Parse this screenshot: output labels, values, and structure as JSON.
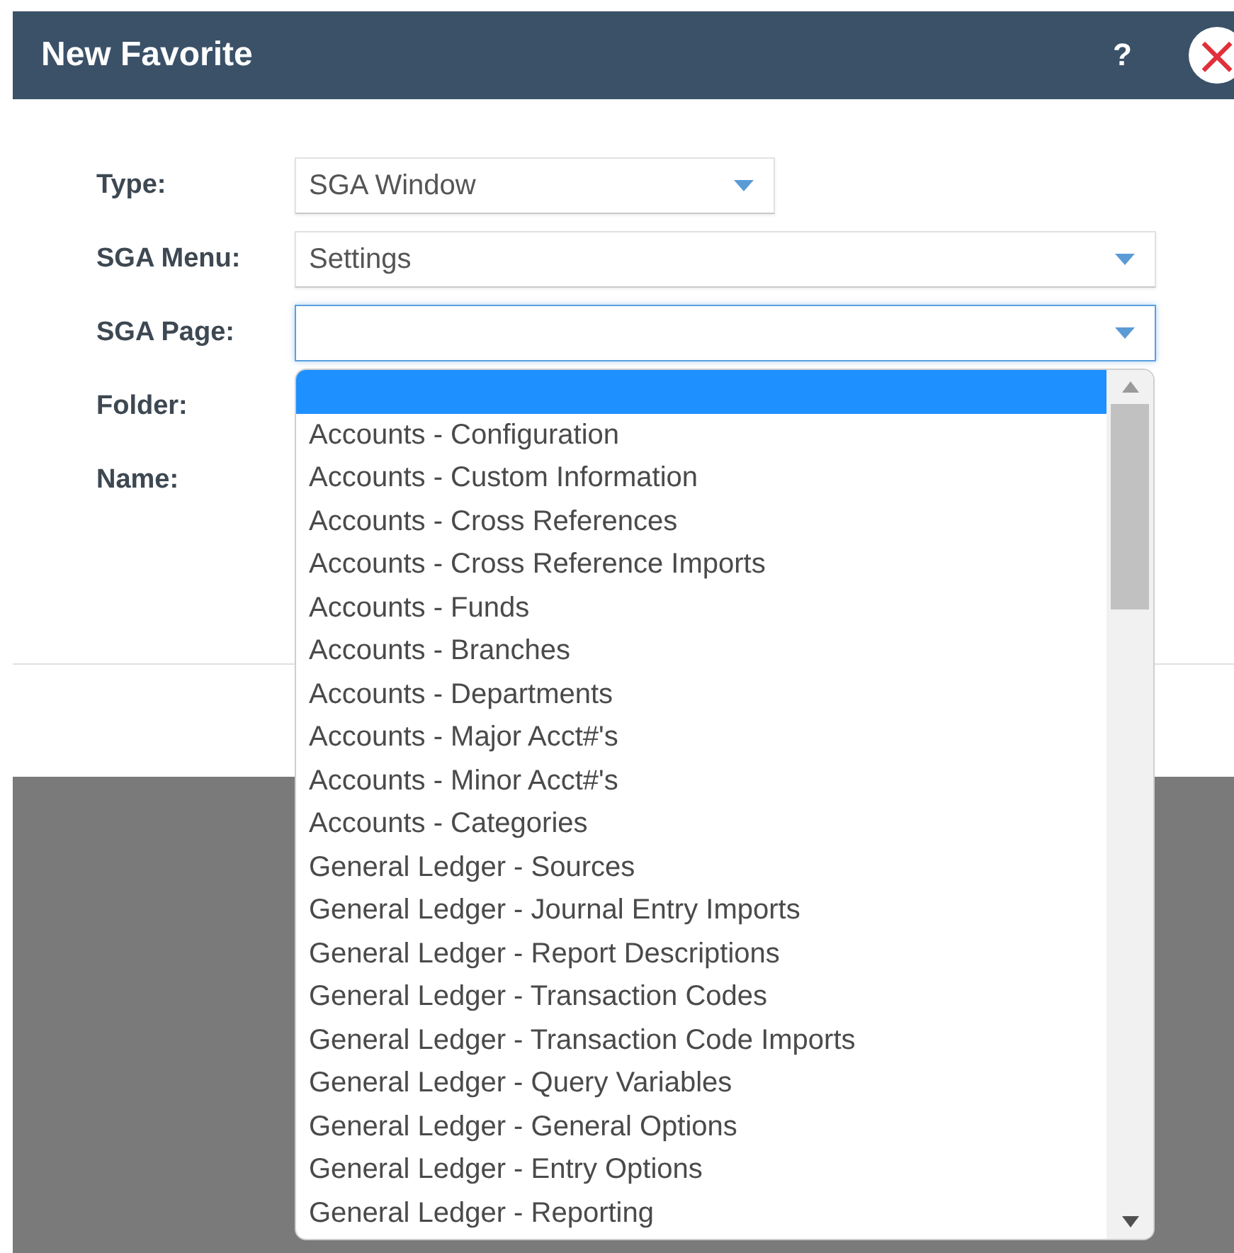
{
  "dialog": {
    "title": "New Favorite",
    "help": "?",
    "close": "×"
  },
  "fields": [
    {
      "label": "Type:",
      "kind": "select",
      "value": "SGA Window",
      "focused": false
    },
    {
      "label": "SGA Menu:",
      "kind": "select",
      "value": "Settings",
      "focused": false
    },
    {
      "label": "SGA Page:",
      "kind": "select",
      "focused": true
    },
    {
      "label": "Folder:",
      "kind": "covered"
    },
    {
      "label": "Name:",
      "kind": "covered"
    }
  ],
  "dropdown": {
    "options": [
      {
        "selected": true
      },
      {
        "label": "Accounts - Configuration",
        "selected": false
      },
      {
        "label": "Accounts - Custom Information",
        "selected": false
      },
      {
        "label": "Accounts - Cross References",
        "selected": false
      },
      {
        "label": "Accounts - Cross Reference Imports",
        "selected": false
      },
      {
        "label": "Accounts - Funds",
        "selected": false
      },
      {
        "label": "Accounts - Branches",
        "selected": false
      },
      {
        "label": "Accounts - Departments",
        "selected": false
      },
      {
        "label": "Accounts - Major Acct#'s",
        "selected": false
      },
      {
        "label": "Accounts - Minor Acct#'s",
        "selected": false
      },
      {
        "label": "Accounts - Categories",
        "selected": false
      },
      {
        "label": "General Ledger - Sources",
        "selected": false
      },
      {
        "label": "General Ledger - Journal Entry Imports",
        "selected": false
      },
      {
        "label": "General Ledger - Report Descriptions",
        "selected": false
      },
      {
        "label": "General Ledger - Transaction Codes",
        "selected": false
      },
      {
        "label": "General Ledger - Transaction Code Imports",
        "selected": false
      },
      {
        "label": "General Ledger - Query Variables",
        "selected": false
      },
      {
        "label": "General Ledger - General Options",
        "selected": false
      },
      {
        "label": "General Ledger - Entry Options",
        "selected": false
      },
      {
        "label": "General Ledger - Reporting",
        "selected": false
      }
    ]
  }
}
